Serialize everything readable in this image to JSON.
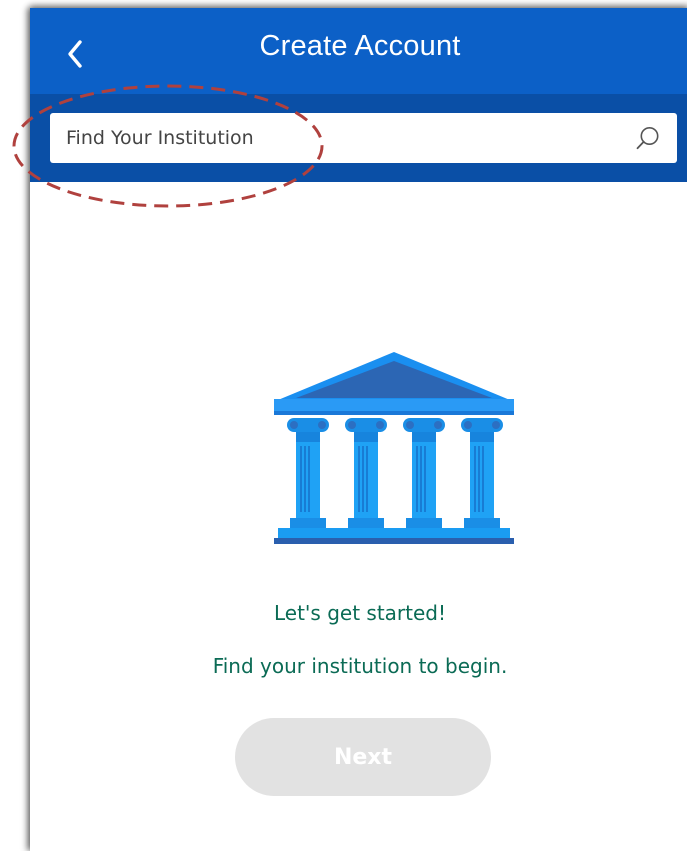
{
  "header": {
    "title": "Create Account",
    "back_icon": "chevron-left-icon"
  },
  "search": {
    "placeholder": "Find Your Institution",
    "value": "",
    "icon": "search-icon"
  },
  "illustration": {
    "icon": "institution-building-icon"
  },
  "message": {
    "line1": "Let's get started!",
    "line2": "Find your institution to begin."
  },
  "actions": {
    "next_label": "Next",
    "next_enabled": false
  },
  "colors": {
    "header_bg": "#0c60c7",
    "search_band_bg": "#0a4fa6",
    "message_text": "#0b6b55",
    "button_disabled_bg": "#e2e2e2",
    "annotation": "#b0413e"
  }
}
